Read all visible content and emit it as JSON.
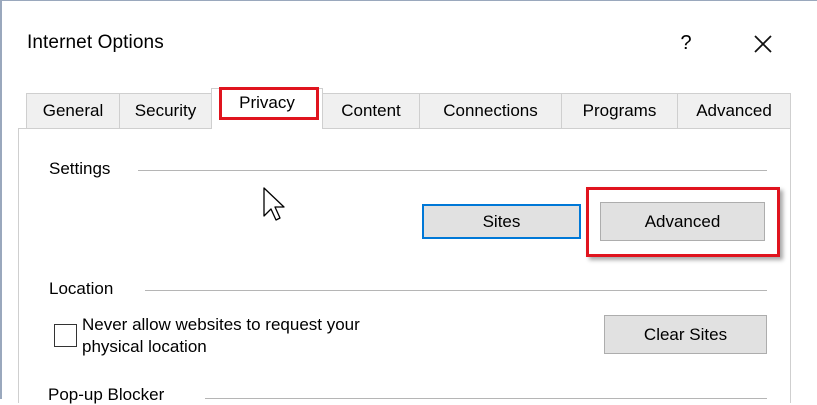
{
  "window": {
    "title": "Internet Options",
    "help_label": "?",
    "close_icon": "close-icon"
  },
  "tabs": [
    {
      "label": "General"
    },
    {
      "label": "Security"
    },
    {
      "label": "Privacy"
    },
    {
      "label": "Content"
    },
    {
      "label": "Connections"
    },
    {
      "label": "Programs"
    },
    {
      "label": "Advanced"
    }
  ],
  "active_tab": "Privacy",
  "settings": {
    "group_title": "Settings",
    "sites_button": "Sites",
    "advanced_button": "Advanced"
  },
  "location": {
    "group_title": "Location",
    "checkbox_label_line1": "Never allow websites to request your",
    "checkbox_label_line2": "physical location",
    "checkbox_checked": false,
    "clear_sites_button": "Clear Sites"
  },
  "popup_blocker": {
    "group_title": "Pop-up Blocker"
  },
  "highlight_color": "#e0141e",
  "focus_color": "#0078d7"
}
